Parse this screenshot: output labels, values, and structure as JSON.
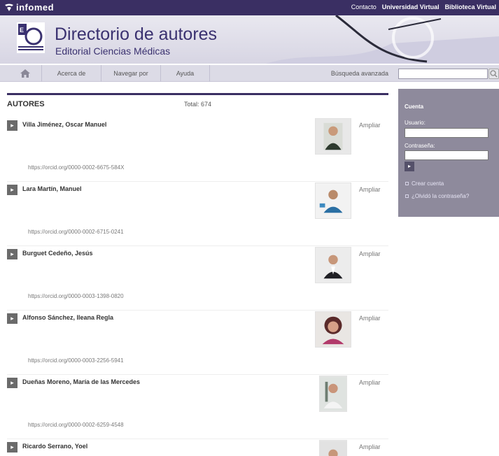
{
  "topbar": {
    "logo_text": "infomed",
    "links": [
      "Contacto",
      "Universidad Virtual",
      "Biblioteca Virtual"
    ]
  },
  "header": {
    "title": "Directorio de autores",
    "subtitle": "Editorial Ciencias Médicas"
  },
  "nav": {
    "home_icon": "home-icon",
    "items": [
      "Acerca de",
      "Navegar por",
      "Ayuda"
    ],
    "advanced_search": "Búsqueda avanzada",
    "search_placeholder": ""
  },
  "main": {
    "heading": "AUTORES",
    "total": "Total: 674",
    "ampliar_label": "Ampliar",
    "authors": [
      {
        "name": "Villa Jiménez, Oscar Manuel",
        "orcid": "https://orcid.org/0000-0002-6675-584X"
      },
      {
        "name": "Lara Martín, Manuel",
        "orcid": "https://orcid.org/0000-0002-6715-0241"
      },
      {
        "name": "Burguet Cedeño, Jesús",
        "orcid": "https://orcid.org/0000-0003-1398-0820"
      },
      {
        "name": "Alfonso Sánchez, Ileana Regla",
        "orcid": "https://orcid.org/0000-0003-2256-5941"
      },
      {
        "name": "Dueñas Moreno, María de las Mercedes",
        "orcid": "https://orcid.org/0000-0002-6259-4548"
      },
      {
        "name": "Ricardo Serrano, Yoel",
        "orcid": ""
      }
    ]
  },
  "sidebar": {
    "title": "Cuenta",
    "user_label": "Usuario:",
    "password_label": "Contraseña:",
    "links": [
      "Crear cuenta",
      "¿Olvidó la contraseña?"
    ]
  },
  "colors": {
    "brand": "#3a2f63",
    "sidebar_bg": "#8e8a9c"
  }
}
